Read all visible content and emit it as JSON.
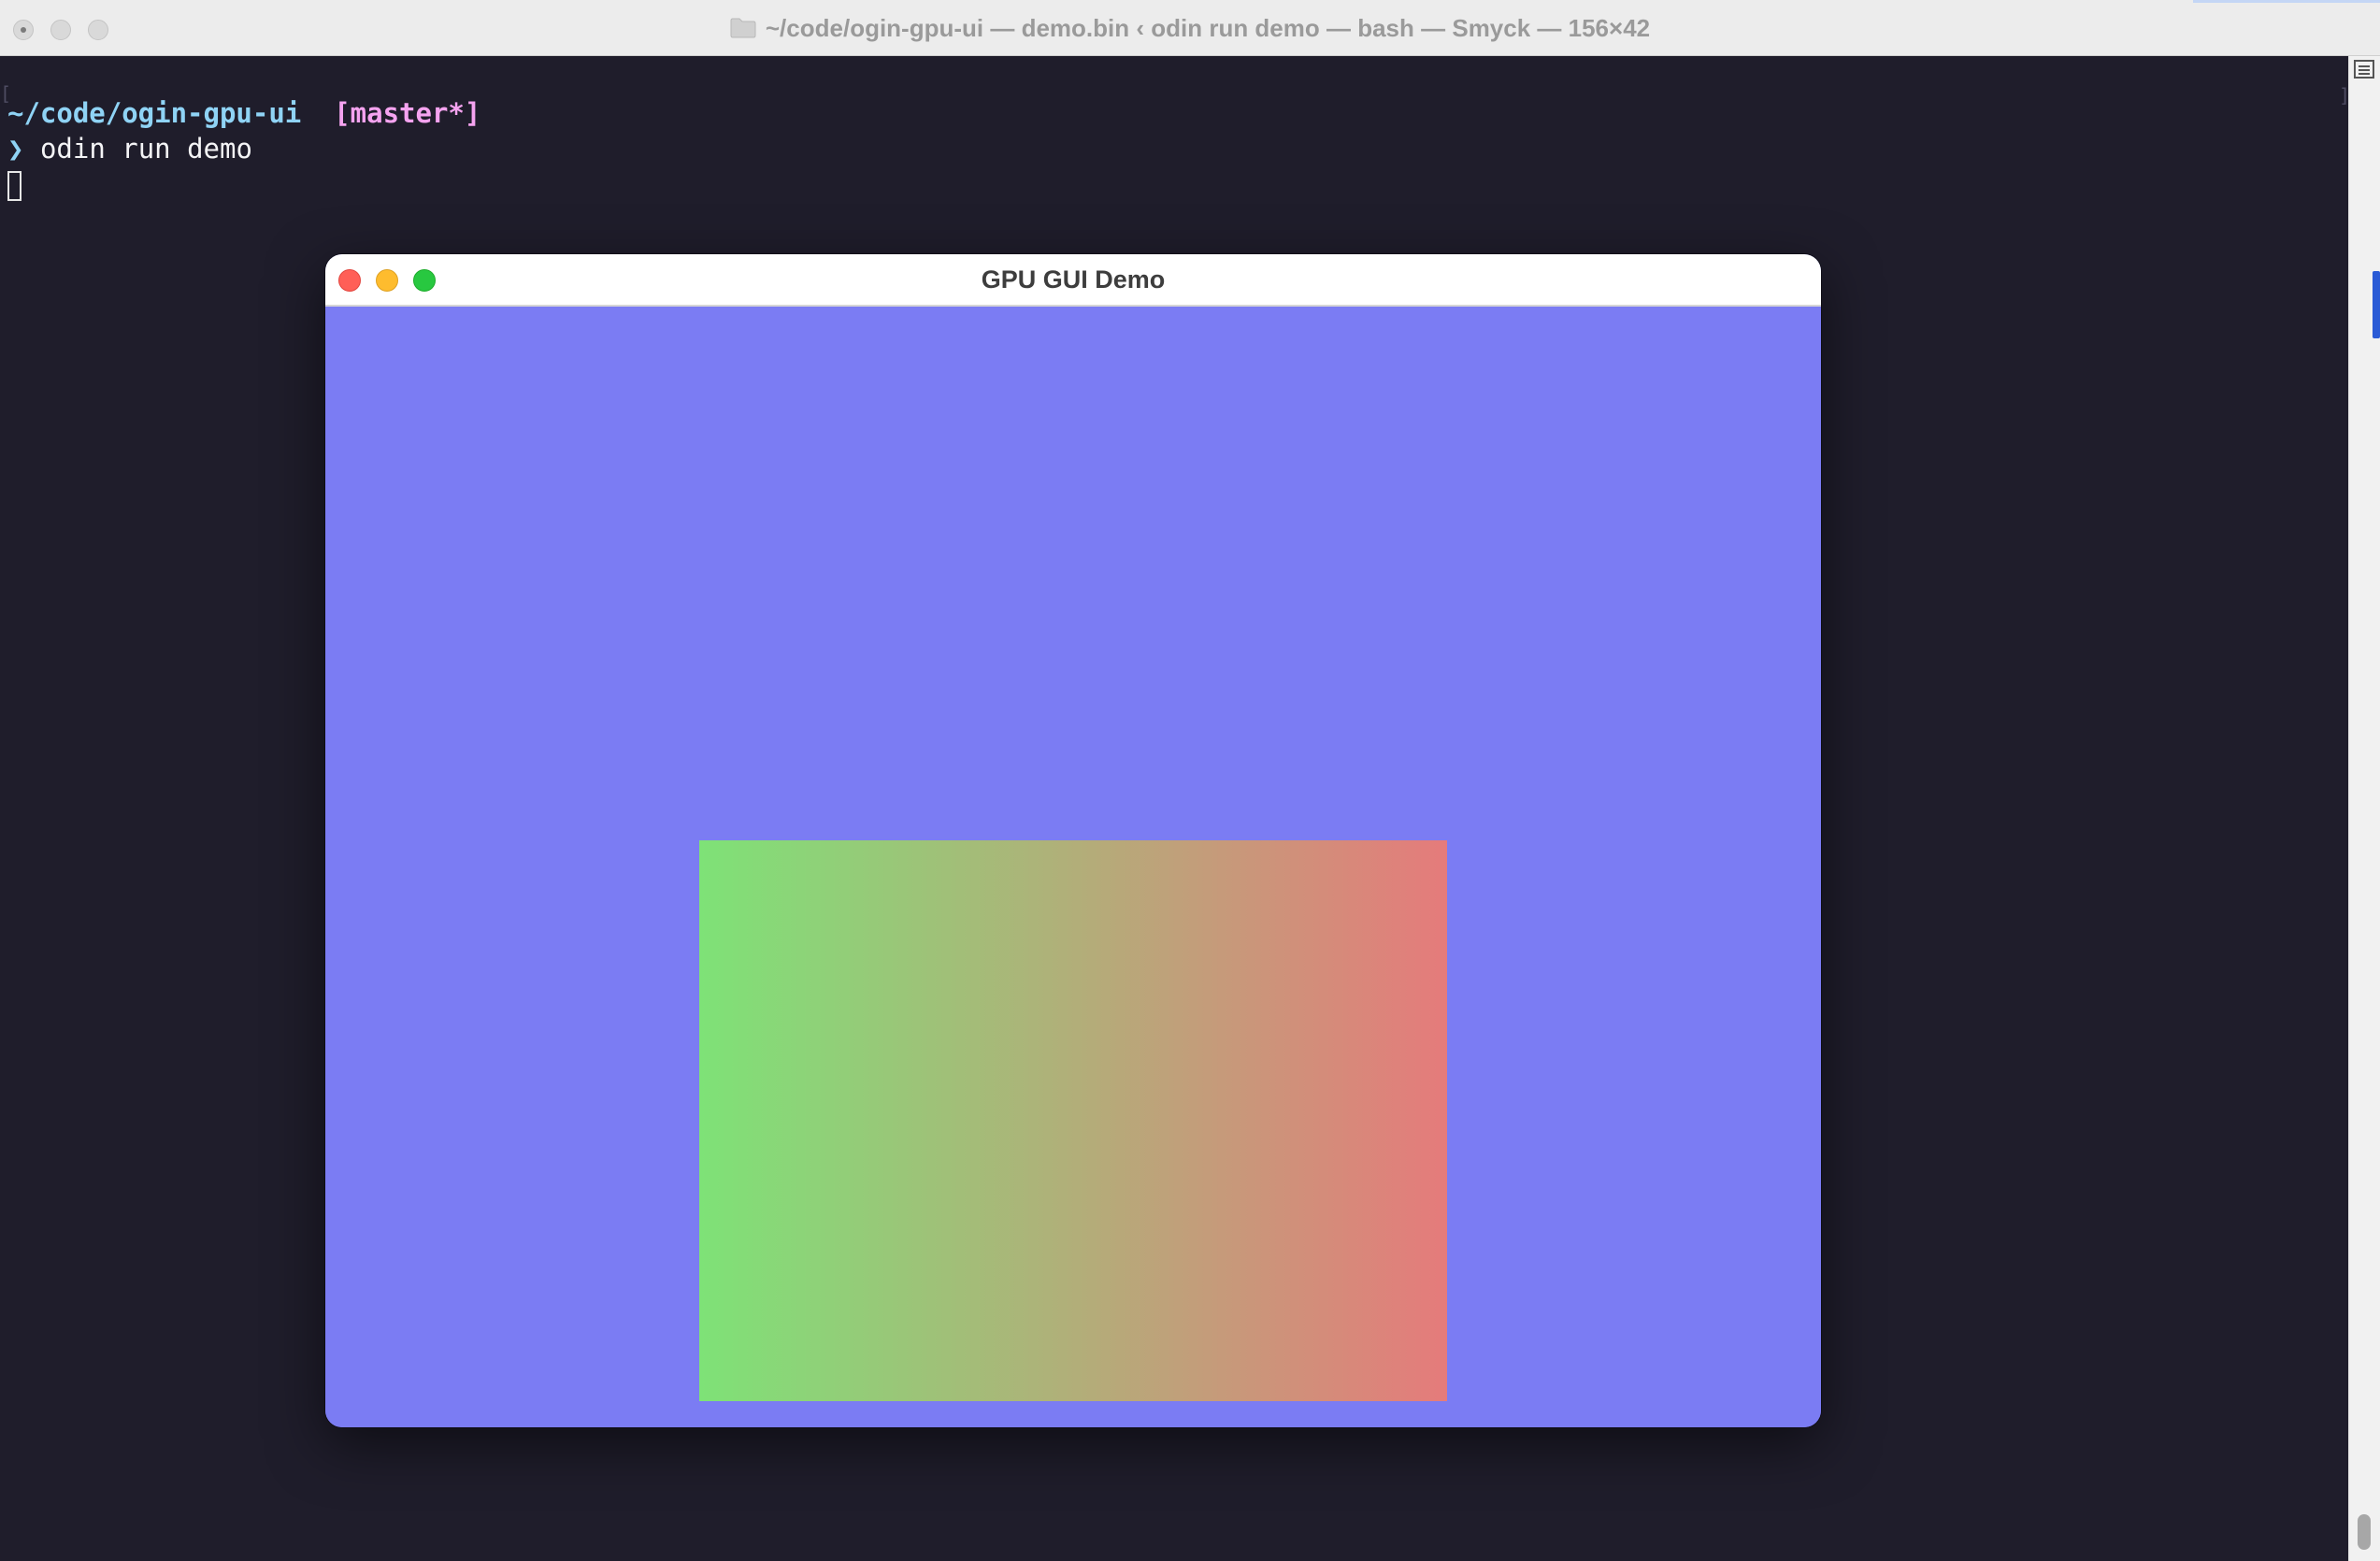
{
  "terminal": {
    "window_title": "~/code/ogin-gpu-ui — demo.bin ‹ odin run demo — bash — Smyck — 156×42",
    "cwd": "~/code/ogin-gpu-ui",
    "branch": "[master*]",
    "prompt_symbol": "❯",
    "command": "odin run demo",
    "left_marker": "[",
    "right_marker": "]"
  },
  "demo_window": {
    "title": "GPU GUI Demo",
    "background_color": "#7b7cf3",
    "traffic_lights": [
      "close",
      "minimize",
      "maximize"
    ],
    "gradient": {
      "start_color": "#7ee277",
      "end_color": "#e57b7b",
      "direction": "left-to-right"
    }
  },
  "colors": {
    "terminal_background": "#1f1d2b",
    "cwd_color": "#8fd3f5",
    "branch_color": "#f5a3f0",
    "command_color": "#f4f4f6"
  },
  "icons": [
    "folder-icon",
    "window-close-icon",
    "window-minimize-icon",
    "window-maximize-icon",
    "terminal-cursor"
  ]
}
